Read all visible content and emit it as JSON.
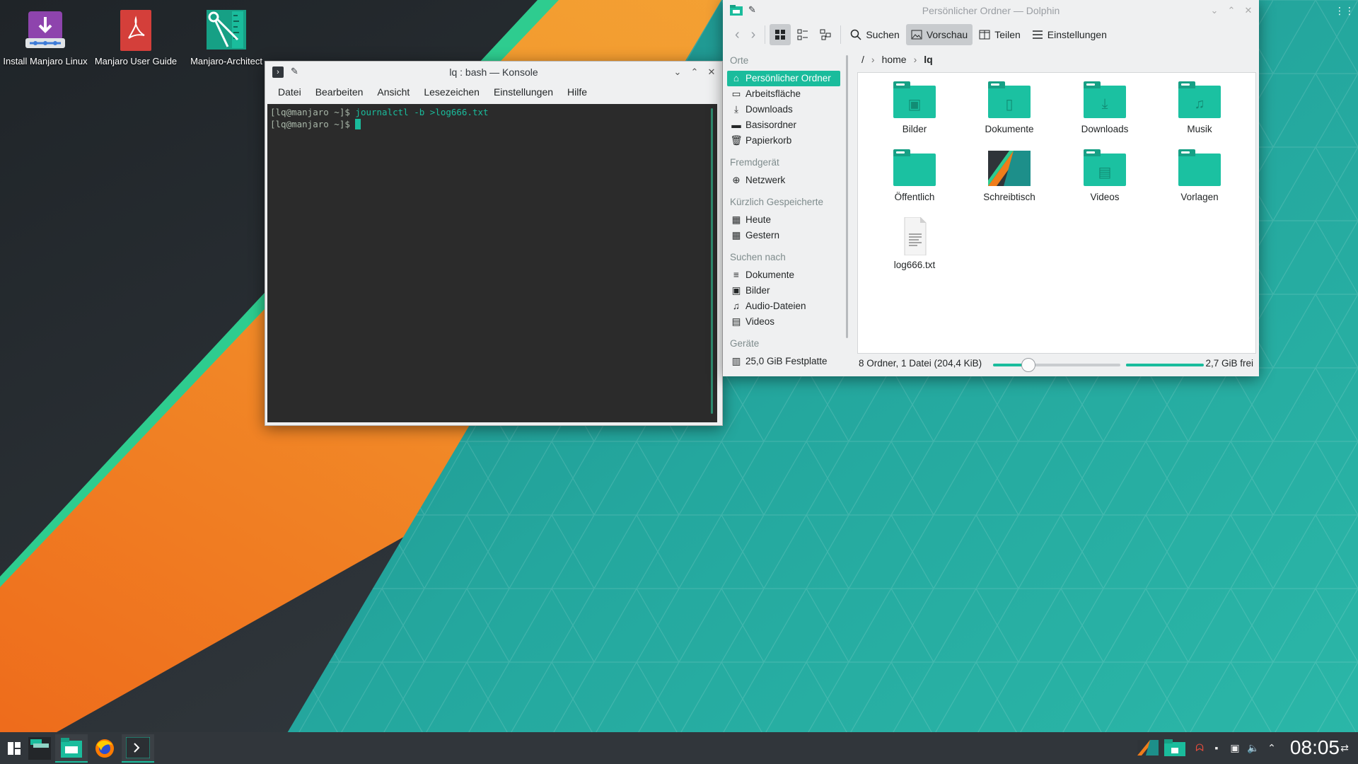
{
  "desktop": {
    "icons": [
      {
        "label": "Install Manjaro Linux"
      },
      {
        "label": "Manjaro User Guide"
      },
      {
        "label": "Manjaro-Architect"
      }
    ]
  },
  "konsole": {
    "title": "lq : bash — Konsole",
    "menu": [
      "Datei",
      "Bearbeiten",
      "Ansicht",
      "Lesezeichen",
      "Einstellungen",
      "Hilfe"
    ],
    "lines": [
      {
        "prompt": "[lq@manjaro ~]$",
        "command": " journalctl -b >log666.txt"
      },
      {
        "prompt": "[lq@manjaro ~]$",
        "command": " "
      }
    ]
  },
  "dolphin": {
    "title": "Persönlicher Ordner — Dolphin",
    "toolbar": {
      "search": "Suchen",
      "preview": "Vorschau",
      "split": "Teilen",
      "settings": "Einstellungen"
    },
    "places": {
      "orte_header": "Orte",
      "orte": [
        "Persönlicher Ordner",
        "Arbeitsfläche",
        "Downloads",
        "Basisordner",
        "Papierkorb"
      ],
      "remote_header": "Fremdgerät",
      "remote": [
        "Netzwerk"
      ],
      "recent_header": "Kürzlich Gespeicherte",
      "recent": [
        "Heute",
        "Gestern"
      ],
      "search_header": "Suchen nach",
      "search": [
        "Dokumente",
        "Bilder",
        "Audio-Dateien",
        "Videos"
      ],
      "devices_header": "Geräte",
      "devices": [
        "25,0 GiB Festplatte"
      ]
    },
    "breadcrumb": {
      "root": "/",
      "home": "home",
      "current": "lq"
    },
    "files": [
      {
        "name": "Bilder",
        "icon": "folder-pictures-icon"
      },
      {
        "name": "Dokumente",
        "icon": "folder-documents-icon"
      },
      {
        "name": "Downloads",
        "icon": "folder-downloads-icon"
      },
      {
        "name": "Musik",
        "icon": "folder-music-icon"
      },
      {
        "name": "Öffentlich",
        "icon": "folder-public-icon"
      },
      {
        "name": "Schreibtisch",
        "icon": "folder-desktop-icon"
      },
      {
        "name": "Videos",
        "icon": "folder-videos-icon"
      },
      {
        "name": "Vorlagen",
        "icon": "folder-templates-icon"
      },
      {
        "name": "log666.txt",
        "icon": "text-file-icon"
      }
    ],
    "status": {
      "summary": "8 Ordner, 1 Datei (204,4 KiB)",
      "free": "2,7 GiB frei",
      "zoom_fraction": 0.27,
      "disk_used_fraction": 0.88
    }
  },
  "taskbar": {
    "clock": "08:05"
  },
  "colors": {
    "accent": "#1abc9c",
    "wallpaper_teal": "#21a39b",
    "wallpaper_orange": "#f07d1a",
    "wallpaper_dark": "#2d3338"
  }
}
